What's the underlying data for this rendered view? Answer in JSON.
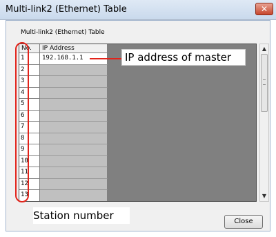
{
  "window": {
    "title": "Multi-link2 (Ethernet) Table",
    "close_glyph": "✕"
  },
  "table_label": "Multi-link2 (Ethernet) Table",
  "columns": {
    "no": "No.",
    "ip": "IP Address"
  },
  "rows": [
    {
      "no": "1",
      "ip": "192.168.1.1"
    },
    {
      "no": "2",
      "ip": ""
    },
    {
      "no": "3",
      "ip": ""
    },
    {
      "no": "4",
      "ip": ""
    },
    {
      "no": "5",
      "ip": ""
    },
    {
      "no": "6",
      "ip": ""
    },
    {
      "no": "7",
      "ip": ""
    },
    {
      "no": "8",
      "ip": ""
    },
    {
      "no": "9",
      "ip": ""
    },
    {
      "no": "10",
      "ip": ""
    },
    {
      "no": "11",
      "ip": ""
    },
    {
      "no": "12",
      "ip": ""
    },
    {
      "no": "13",
      "ip": ""
    }
  ],
  "annotations": {
    "ip_master": "IP address of master",
    "station_number": "Station number"
  },
  "buttons": {
    "close": "Close"
  },
  "colors": {
    "annotation": "#e2231a",
    "empty_cell": "#c0c0c0",
    "grid_area": "#808080"
  }
}
